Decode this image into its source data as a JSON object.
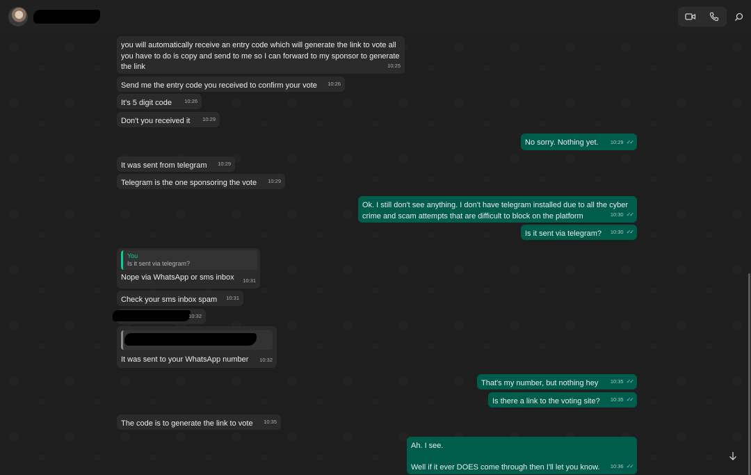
{
  "contact": {
    "avatar_icon": "avatar"
  },
  "header": {
    "video_icon": "video-camera-icon",
    "call_icon": "phone-icon",
    "search_icon": "search-icon"
  },
  "messages": [
    {
      "dir": "in",
      "text": "you will automatically receive an entry code which will generate the link to vote all you have to do is copy and send to me so I can forward to my sponsor to generate the link",
      "time": "10:25"
    },
    {
      "dir": "in",
      "text": "Send me the entry code you received to confirm your vote",
      "time": "10:26"
    },
    {
      "dir": "in",
      "text": "It's 5 digit code",
      "time": "10:26"
    },
    {
      "dir": "in",
      "text": "Don't you received it",
      "time": "10:29"
    },
    {
      "dir": "out",
      "text": "No sorry. Nothing yet.",
      "time": "10:29"
    },
    {
      "dir": "in",
      "text": "It was sent from telegram",
      "time": "10:29"
    },
    {
      "dir": "in",
      "text": "Telegram is the one sponsoring the vote",
      "time": "10:29"
    },
    {
      "dir": "out",
      "text": "Ok. I still don't see anything. I don't have telegram installed due to all the cyber crime and scam attempts that are difficult to block on the platform",
      "time": "10:30"
    },
    {
      "dir": "out",
      "text": "Is it sent via telegram?",
      "time": "10:30"
    },
    {
      "dir": "in",
      "quote_author": "You",
      "quote_text": "Is it sent via telegram?",
      "text": "Nope via WhatsApp or sms inbox",
      "time": "10:31"
    },
    {
      "dir": "in",
      "text": "Check your sms inbox spam",
      "time": "10:31"
    },
    {
      "dir": "in",
      "text": "",
      "time": "10:32"
    },
    {
      "dir": "in",
      "text": "It was sent to your WhatsApp number",
      "time": "10:32"
    },
    {
      "dir": "out",
      "text": "That's my number, but nothing hey",
      "time": "10:35"
    },
    {
      "dir": "out",
      "text": "Is there a link to the voting site?",
      "time": "10:35"
    },
    {
      "dir": "in",
      "text": "The code is to generate the link to vote",
      "time": "10:35"
    },
    {
      "dir": "out",
      "text": "Ah. I see.",
      "text2": "Well if it ever DOES come through then I'll let you know.",
      "time": "10:36"
    }
  ]
}
